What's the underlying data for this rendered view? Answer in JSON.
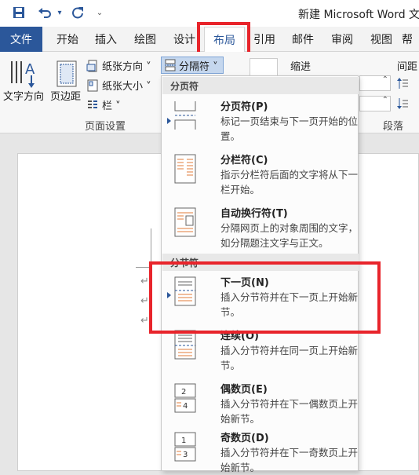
{
  "window": {
    "title": "新建 Microsoft Word 文档"
  },
  "qat": {
    "save_icon": "save-icon",
    "undo_icon": "undo-icon",
    "redo_icon": "redo-icon",
    "more_icon": "customize-icon"
  },
  "tabs": [
    {
      "label": "文件"
    },
    {
      "label": "开始"
    },
    {
      "label": "插入"
    },
    {
      "label": "绘图"
    },
    {
      "label": "设计"
    },
    {
      "label": "布局"
    },
    {
      "label": "引用"
    },
    {
      "label": "邮件"
    },
    {
      "label": "审阅"
    },
    {
      "label": "视图"
    },
    {
      "label": "帮"
    }
  ],
  "ribbon": {
    "text_direction": "文字方向",
    "margins": "页边距",
    "orientation": "纸张方向 ˅",
    "size": "纸张大小 ˅",
    "columns": "栏 ˅",
    "breaks": "分隔符 ˅",
    "indent": "缩进",
    "spacing": "间距",
    "page_setup_group": "页面设置",
    "paragraph_group": "段落"
  },
  "dropdown": {
    "page_breaks_header": "分页符",
    "section_breaks_header": "分节符",
    "items": [
      {
        "title": "分页符(P)",
        "desc": "标记一页结束与下一页开始的位置。"
      },
      {
        "title": "分栏符(C)",
        "desc": "指示分栏符后面的文字将从下一栏开始。"
      },
      {
        "title": "自动换行符(T)",
        "desc": "分隔网页上的对象周围的文字，如分隔题注文字与正文。"
      },
      {
        "title": "下一页(N)",
        "desc": "插入分节符并在下一页上开始新节。"
      },
      {
        "title": "连续(O)",
        "desc": "插入分节符并在同一页上开始新节。"
      },
      {
        "title": "偶数页(E)",
        "desc": "插入分节符并在下一偶数页上开始新节。"
      },
      {
        "title": "奇数页(D)",
        "desc": "插入分节符并在下一奇数页上开始新节。"
      }
    ]
  },
  "colors": {
    "accent": "#2b579a",
    "highlight": "#e8242b"
  }
}
